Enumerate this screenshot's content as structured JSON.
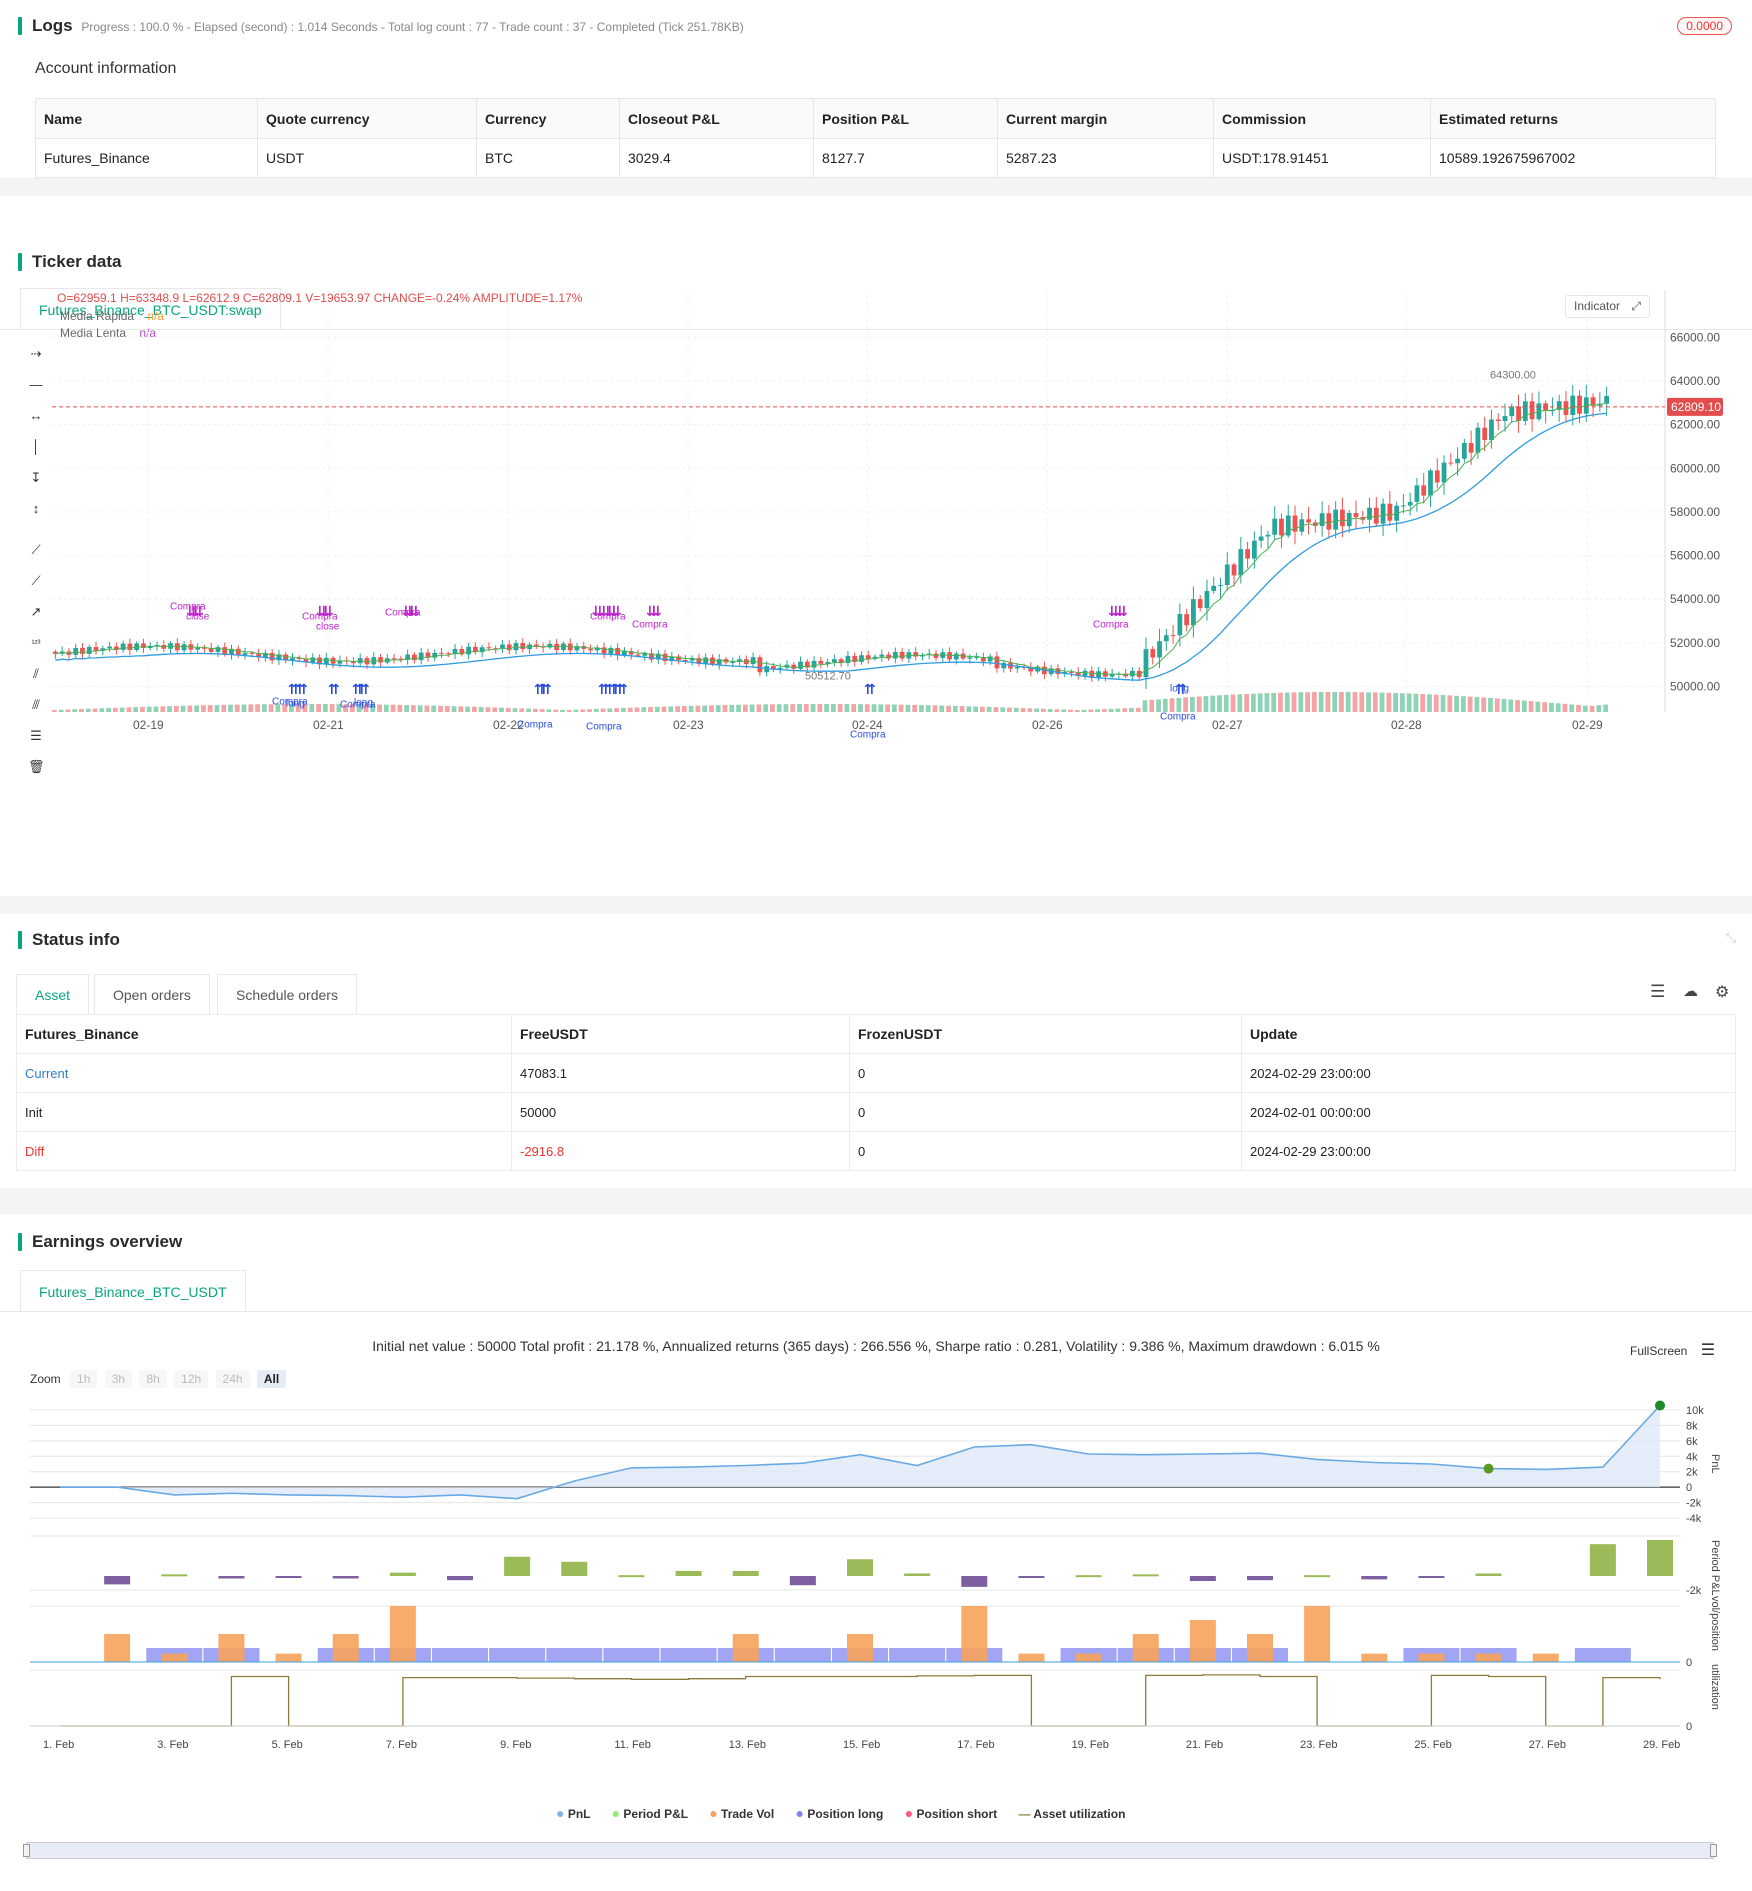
{
  "logs": {
    "title": "Logs",
    "progress": "Progress : 100.0 % - Elapsed (second) : 1.014  Seconds - Total log count : 77 - Trade count : 37 - Completed (Tick 251.78KB)",
    "badge": "0.0000",
    "account_title": "Account information",
    "headers": [
      "Name",
      "Quote currency",
      "Currency",
      "Closeout P&L",
      "Position P&L",
      "Current margin",
      "Commission",
      "Estimated returns"
    ],
    "row": [
      "Futures_Binance",
      "USDT",
      "BTC",
      "3029.4",
      "8127.7",
      "5287.23",
      "USDT:178.91451",
      "10589.192675967002"
    ]
  },
  "ticker": {
    "title": "Ticker data",
    "tab": "Futures_Binance_BTC_USDT:swap",
    "ohlc": {
      "o": "O=62959.1",
      "h": "H=63348.9",
      "l": "L=62612.9",
      "c": "C=62809.1",
      "v": "V=19653.97",
      "change": "CHANGE=-0.24%",
      "amp": "AMPLITUDE=1.17%"
    },
    "legend": [
      {
        "name": "Media Rápida",
        "value": "n/a",
        "color": "#f0a030"
      },
      {
        "name": "Media Lenta",
        "value": "n/a",
        "color": "#b050d0"
      }
    ],
    "indicator_button": "Indicator",
    "price_ticks": [
      "66000.00",
      "64000.00",
      "62000.00",
      "60000.00",
      "58000.00",
      "56000.00",
      "54000.00",
      "52000.00",
      "50000.00"
    ],
    "date_ticks": [
      "02-19",
      "02-21",
      "02-22",
      "02-23",
      "02-24",
      "02-26",
      "02-27",
      "02-28",
      "02-29"
    ],
    "last_price": "62809.10",
    "high_mark": "64300.00",
    "low_mark": "50512.70",
    "signal_labels": [
      "Compra",
      "close",
      "long",
      "1"
    ]
  },
  "status": {
    "title": "Status info",
    "tabs": [
      "Asset",
      "Open orders",
      "Schedule orders"
    ],
    "headers": [
      "Futures_Binance",
      "FreeUSDT",
      "FrozenUSDT",
      "Update"
    ],
    "rows": [
      [
        "Current",
        "47083.1",
        "0",
        "2024-02-29 23:00:00"
      ],
      [
        "Init",
        "50000",
        "0",
        "2024-02-01 00:00:00"
      ],
      [
        "Diff",
        "-2916.8",
        "0",
        "2024-02-29 23:00:00"
      ]
    ]
  },
  "earnings": {
    "title": "Earnings overview",
    "tab": "Futures_Binance_BTC_USDT",
    "summary": "Initial net value : 50000  Total profit : 21.178 %, Annualized returns (365 days) : 266.556 %, Sharpe ratio : 0.281, Volatility : 9.386 %, Maximum drawdown : 6.015 %",
    "fullscreen": "FullScreen",
    "zoom_label": "Zoom",
    "zoom_options": [
      "1h",
      "3h",
      "8h",
      "12h",
      "24h",
      "All"
    ],
    "pnl_ticks": [
      "10k",
      "8k",
      "6k",
      "4k",
      "2k",
      "0",
      "-2k",
      "-4k"
    ],
    "period_ticks": [
      "-2k"
    ],
    "vol_ticks": [
      "0"
    ],
    "util_ticks": [
      "0"
    ],
    "axis_labels": [
      "PnL",
      "Period P&L",
      "vol/position",
      "utilization"
    ],
    "x_dates": [
      "1. Feb",
      "3. Feb",
      "5. Feb",
      "7. Feb",
      "9. Feb",
      "11. Feb",
      "13. Feb",
      "15. Feb",
      "17. Feb",
      "19. Feb",
      "21. Feb",
      "23. Feb",
      "25. Feb",
      "27. Feb",
      "29. Feb"
    ],
    "legend": [
      {
        "name": "PnL",
        "color": "#7cb5ec"
      },
      {
        "name": "Period P&L",
        "color": "#90ed7d"
      },
      {
        "name": "Trade Vol",
        "color": "#f7a35c"
      },
      {
        "name": "Position long",
        "color": "#8085e9"
      },
      {
        "name": "Position short",
        "color": "#f15c80"
      },
      {
        "name": "Asset utilization",
        "color": "#8d7b3a"
      }
    ]
  },
  "chart_data": [
    {
      "type": "line",
      "title": "",
      "xlabel": "",
      "ylabel": "PnL",
      "x": [
        "1. Feb",
        "2. Feb",
        "3. Feb",
        "4. Feb",
        "5. Feb",
        "6. Feb",
        "7. Feb",
        "8. Feb",
        "9. Feb",
        "10. Feb",
        "11. Feb",
        "12. Feb",
        "13. Feb",
        "14. Feb",
        "15. Feb",
        "16. Feb",
        "17. Feb",
        "18. Feb",
        "19. Feb",
        "20. Feb",
        "21. Feb",
        "22. Feb",
        "23. Feb",
        "24. Feb",
        "25. Feb",
        "26. Feb",
        "27. Feb",
        "28. Feb",
        "29. Feb"
      ],
      "series": [
        {
          "name": "PnL",
          "values": [
            0,
            0,
            -1000,
            -800,
            -1000,
            -1100,
            -1300,
            -1000,
            -1500,
            800,
            2500,
            2600,
            2800,
            3100,
            4200,
            2800,
            5200,
            5500,
            4300,
            4200,
            4300,
            4400,
            3600,
            3200,
            3000,
            2400,
            2300,
            2600,
            10589
          ]
        }
      ],
      "ylim": [
        -4000,
        10000
      ]
    },
    {
      "type": "bar",
      "title": "",
      "ylabel": "Period P&L",
      "categories": [
        "1. Feb",
        "2. Feb",
        "3. Feb",
        "4. Feb",
        "5. Feb",
        "6. Feb",
        "7. Feb",
        "8. Feb",
        "9. Feb",
        "10. Feb",
        "11. Feb",
        "12. Feb",
        "13. Feb",
        "14. Feb",
        "15. Feb",
        "16. Feb",
        "17. Feb",
        "18. Feb",
        "19. Feb",
        "20. Feb",
        "21. Feb",
        "22. Feb",
        "23. Feb",
        "24. Feb",
        "25. Feb",
        "26. Feb",
        "27. Feb",
        "28. Feb",
        "29. Feb"
      ],
      "values": [
        0,
        -1000,
        200,
        -300,
        -100,
        -300,
        400,
        -500,
        2300,
        1700,
        100,
        600,
        600,
        -1100,
        2000,
        300,
        -1300,
        -200,
        100,
        200,
        -600,
        -500,
        100,
        -400,
        -100,
        300,
        0,
        3800,
        4300
      ]
    },
    {
      "type": "bar",
      "title": "",
      "ylabel": "vol/position",
      "categories": [
        "1. Feb",
        "2. Feb",
        "3. Feb",
        "4. Feb",
        "5. Feb",
        "6. Feb",
        "7. Feb",
        "8. Feb",
        "9. Feb",
        "10. Feb",
        "11. Feb",
        "12. Feb",
        "13. Feb",
        "14. Feb",
        "15. Feb",
        "16. Feb",
        "17. Feb",
        "18. Feb",
        "19. Feb",
        "20. Feb",
        "21. Feb",
        "22. Feb",
        "23. Feb",
        "24. Feb",
        "25. Feb",
        "26. Feb",
        "27. Feb",
        "28. Feb",
        "29. Feb"
      ],
      "series": [
        {
          "name": "Trade Vol",
          "values": [
            0,
            1,
            0.3,
            1,
            0.3,
            1,
            2,
            0,
            0,
            0,
            0,
            0,
            1,
            0,
            1,
            0,
            2,
            0.3,
            0.3,
            1,
            1.5,
            1,
            2,
            0.3,
            0.3,
            0.3,
            0.3,
            0,
            0
          ]
        },
        {
          "name": "Position long",
          "values": [
            0,
            0,
            0.5,
            0.5,
            0,
            0.5,
            0.5,
            0.5,
            0.5,
            0.5,
            0.5,
            0.5,
            0.5,
            0.5,
            0.5,
            0.5,
            0.5,
            0,
            0.5,
            0.5,
            0.5,
            0.5,
            0,
            0,
            0.5,
            0.5,
            0,
            0.5,
            0
          ]
        }
      ]
    },
    {
      "type": "line",
      "title": "",
      "ylabel": "utilization",
      "x": [
        "1. Feb",
        "2. Feb",
        "3. Feb",
        "4. Feb",
        "5. Feb",
        "6. Feb",
        "7. Feb",
        "8. Feb",
        "9. Feb",
        "10. Feb",
        "11. Feb",
        "12. Feb",
        "13. Feb",
        "14. Feb",
        "15. Feb",
        "16. Feb",
        "17. Feb",
        "18. Feb",
        "19. Feb",
        "20. Feb",
        "21. Feb",
        "22. Feb",
        "23. Feb",
        "24. Feb",
        "25. Feb",
        "26. Feb",
        "27. Feb",
        "28. Feb",
        "29. Feb"
      ],
      "series": [
        {
          "name": "Asset utilization",
          "values": [
            0,
            0,
            0,
            0.9,
            0,
            0,
            0.88,
            0.88,
            0.87,
            0.86,
            0.85,
            0.86,
            0.9,
            0.9,
            0.9,
            0.91,
            0.92,
            0,
            0,
            0.92,
            0.93,
            0.9,
            0,
            0,
            0.92,
            0.9,
            0,
            0.88,
            0.85
          ]
        }
      ]
    }
  ]
}
